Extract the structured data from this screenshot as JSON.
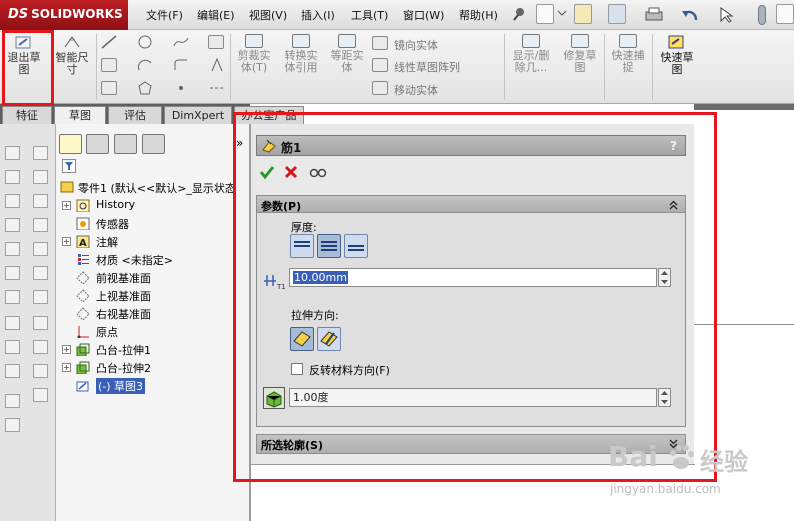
{
  "app": {
    "logo_text": "SOLIDWORKS",
    "logo_prefix": "DS"
  },
  "menu": [
    "文件(F)",
    "编辑(E)",
    "视图(V)",
    "插入(I)",
    "工具(T)",
    "窗口(W)",
    "帮助(H)"
  ],
  "command_manager": {
    "exit_sketch": "退出草图",
    "smart_dimension": "智能尺寸",
    "trim_entities": "剪裁实体(T)",
    "convert_entities": "转换实体引用",
    "offset_entities": "等距实体",
    "mirror_entities": "镜向实体",
    "linear_pattern": "线性草图阵列",
    "move_entities": "移动实体",
    "display_delete_relations": "显示/删除几...",
    "repair_sketch": "修复草图",
    "quick_snaps": "快速捕捉",
    "rapid_sketch": "快速草图"
  },
  "tabs": [
    "特征",
    "草图",
    "评估",
    "DimXpert",
    "办公室产品"
  ],
  "active_tab": "草图",
  "feature_tree": {
    "root": "零件1 (默认<<默认>_显示状态",
    "items": [
      {
        "label": "History",
        "expandable": true
      },
      {
        "label": "传感器",
        "expandable": false
      },
      {
        "label": "注解",
        "expandable": true
      },
      {
        "label": "材质 <未指定>",
        "expandable": false
      },
      {
        "label": "前视基准面",
        "expandable": false
      },
      {
        "label": "上视基准面",
        "expandable": false
      },
      {
        "label": "右视基准面",
        "expandable": false
      },
      {
        "label": "原点",
        "expandable": false
      },
      {
        "label": "凸台-拉伸1",
        "expandable": true
      },
      {
        "label": "凸台-拉伸2",
        "expandable": true
      },
      {
        "label": "(-) 草图3",
        "expandable": false,
        "selected": true
      }
    ],
    "collapse_arrow": "»"
  },
  "property_manager": {
    "title": "筋1",
    "help": "?",
    "params_group": {
      "title": "参数(P)",
      "thickness_label": "厚度:",
      "thickness_value": "10.00mm",
      "extrude_direction_label": "拉伸方向:",
      "flip_material_label": "反转材料方向(F)",
      "flip_material_checked": false,
      "draft_value": "1.00度"
    },
    "selected_contours_group": {
      "title": "所选轮廓(S)"
    }
  },
  "watermark": {
    "brand_a": "Bai",
    "brand_b": "经验",
    "url": "jingyan.baidu.com"
  },
  "colors": {
    "highlight_frame": "#e4171f",
    "title_red": "#a8161b",
    "selected_node": "#3a5fb8"
  }
}
